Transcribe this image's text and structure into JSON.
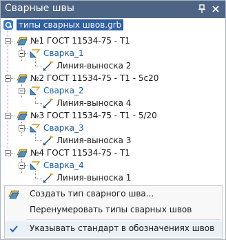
{
  "panel": {
    "title": "Сварные швы",
    "root_label": "типы сварных швов.grb"
  },
  "tree": {
    "groups": [
      {
        "type_label": "№1 ГОСТ 11534-75 - Т1",
        "weld_label": "Сварка_1",
        "leader_label": "Линия-выноска 2"
      },
      {
        "type_label": "№2 ГОСТ 11534-75 - Т1 - 5с20",
        "weld_label": "Сварка_2",
        "leader_label": "Линия-выноска 4"
      },
      {
        "type_label": "№3 ГОСТ 11534-75 - Т1 - 5/20",
        "weld_label": "Сварка_3",
        "leader_label": "Линия-выноска 3"
      },
      {
        "type_label": "№4 ГОСТ 11534-75 - Т1",
        "weld_label": "Сварка_4",
        "leader_label": "Линия-выноска 1"
      }
    ]
  },
  "menu": {
    "create_label": "Создать тип сварного шва...",
    "rename_label": "Перенумеровать типы сварных швов",
    "standard_label": "Указывать стандарт в обозначениях швов",
    "standard_checked": true
  },
  "icons": {
    "pin": "pin-icon",
    "close": "close-icon",
    "root": "document-icon",
    "weld_type": "weld-type-icon",
    "weld": "weld-icon",
    "leader": "leader-line-icon",
    "check": "check-icon"
  },
  "colors": {
    "titlebar": "#4d6485",
    "selection": "#2f5f9f",
    "link_text": "#1a5a9a"
  }
}
